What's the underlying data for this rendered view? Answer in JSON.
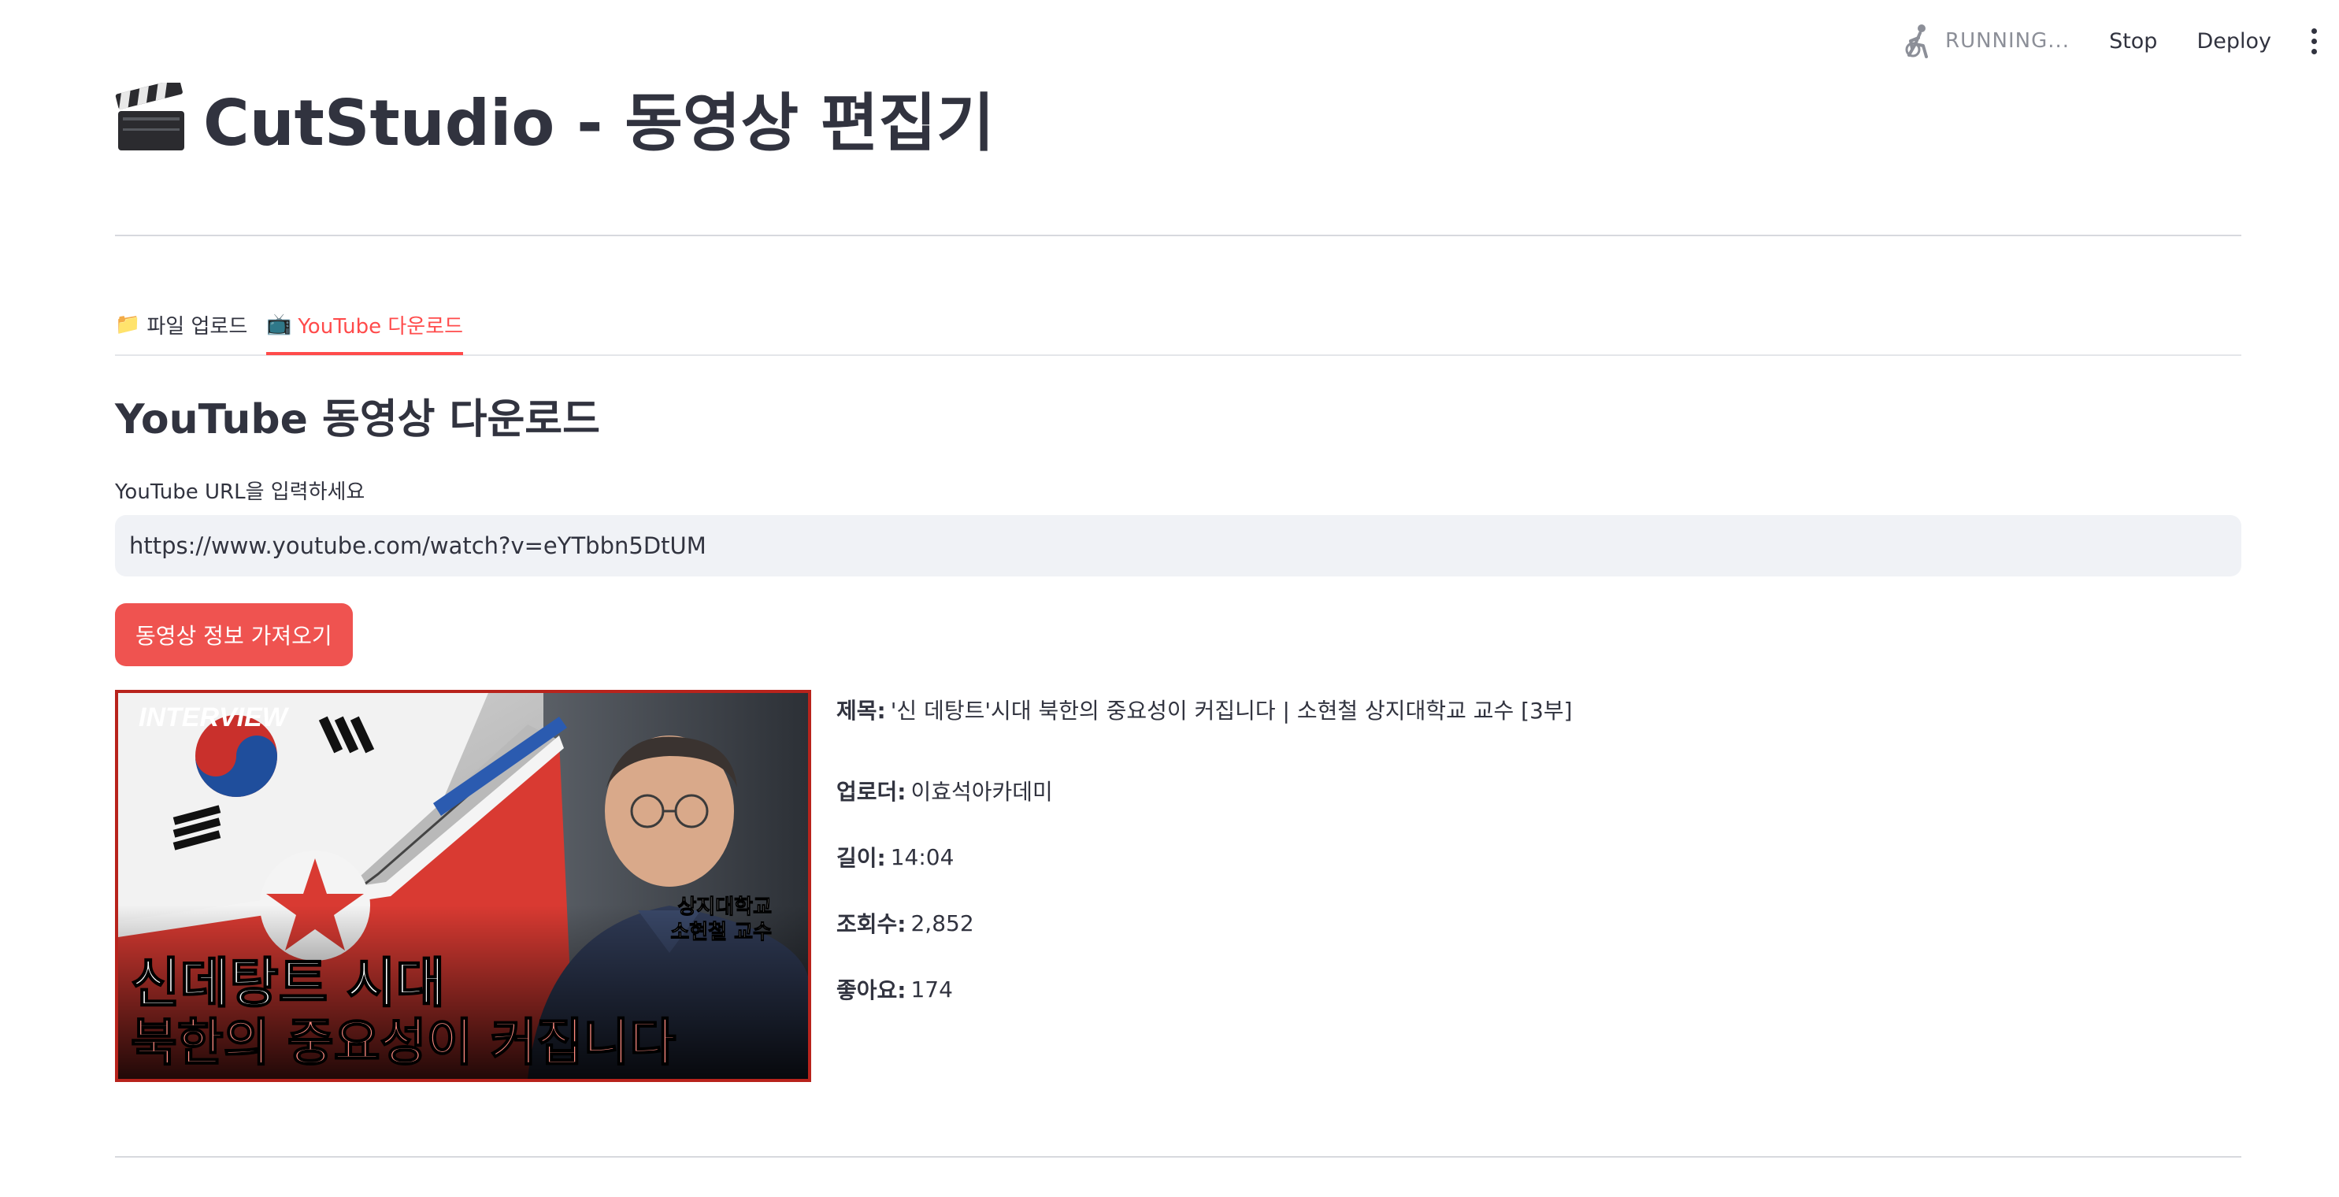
{
  "toolbar": {
    "status": "RUNNING...",
    "stop_label": "Stop",
    "deploy_label": "Deploy",
    "status_icon": "running-figure-icon",
    "menu_icon": "kebab-menu-icon"
  },
  "header": {
    "title_icon": "clapperboard-icon",
    "title": "CutStudio - 동영상 편집기"
  },
  "tabs": [
    {
      "icon": "📁",
      "label": "파일 업로드",
      "active": false
    },
    {
      "icon": "📺",
      "label": "YouTube 다운로드",
      "active": true
    }
  ],
  "youtube": {
    "section_title": "YouTube 동영상 다운로드",
    "url_label": "YouTube URL을 입력하세요",
    "url_value": "https://www.youtube.com/watch?v=eYTbbn5DtUM",
    "fetch_button_label": "동영상 정보 가져오기"
  },
  "thumbnail": {
    "badge": "INTERVIEW",
    "guest_line1": "상지대학교",
    "guest_line2": "소현철 교수",
    "headline_line1": "신데탕트 시대",
    "headline_line2": "북한의 중요성이 커집니다"
  },
  "video_info": [
    {
      "key": "제목:",
      "value": "'신 데탕트'시대 북한의 중요성이 커집니다 | 소현철 상지대학교 교수 [3부]"
    },
    {
      "key": "업로더:",
      "value": "이효석아카데미"
    },
    {
      "key": "길이:",
      "value": "14:04"
    },
    {
      "key": "조회수:",
      "value": "2,852"
    },
    {
      "key": "좋아요:",
      "value": "174"
    }
  ],
  "colors": {
    "accent": "#ff4b4b",
    "button_bg": "#ef5350",
    "text": "#31333f",
    "input_bg": "#f0f2f6"
  }
}
